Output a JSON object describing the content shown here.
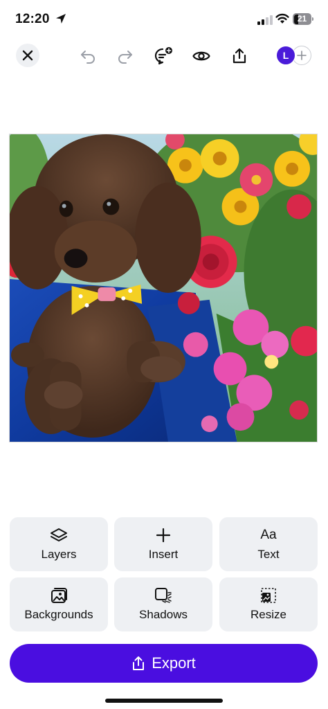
{
  "status_bar": {
    "time": "12:20",
    "battery": "21",
    "icons": [
      "location-arrow-icon",
      "signal-icon",
      "wifi-icon",
      "battery-icon"
    ]
  },
  "toolbar": {
    "icons": [
      "close-icon",
      "undo-icon",
      "redo-icon",
      "comment-add-icon",
      "eye-preview-icon",
      "share-icon"
    ],
    "avatar_initial": "L",
    "add_collaborator_icon": "plus-icon"
  },
  "canvas": {
    "image_alt": "Brown poodle with yellow polka-dot bow sitting on blue cloth beside colorful flowers"
  },
  "tools": [
    {
      "label": "Layers",
      "icon": "layers-icon"
    },
    {
      "label": "Insert",
      "icon": "plus-icon"
    },
    {
      "label": "Text",
      "icon": "text-aa-icon",
      "glyph": "Aa"
    },
    {
      "label": "Backgrounds",
      "icon": "backgrounds-icon"
    },
    {
      "label": "Shadows",
      "icon": "shadows-icon"
    },
    {
      "label": "Resize",
      "icon": "resize-icon"
    }
  ],
  "export": {
    "label": "Export",
    "icon": "share-icon"
  },
  "colors": {
    "accent": "#4a0ee0",
    "avatar": "#4a1bd9",
    "tile_bg": "#eef0f3"
  }
}
